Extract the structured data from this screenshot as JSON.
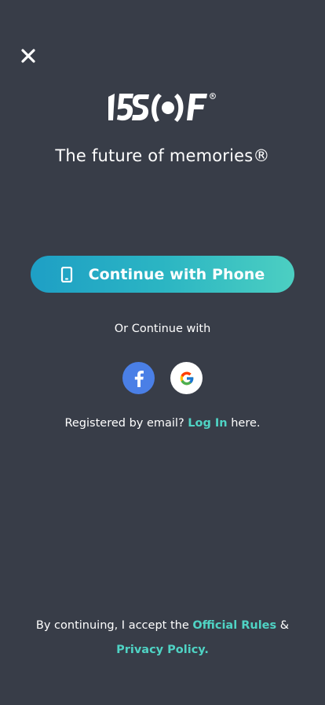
{
  "brand": {
    "logo_alt": "15SOF",
    "tagline": "The future of memories®",
    "accent_color": "#4fd3c4",
    "background_color": "#383d48"
  },
  "header": {
    "close_icon": "close-icon"
  },
  "auth": {
    "phone_button_label": "Continue with Phone",
    "phone_icon": "smartphone-icon",
    "or_continue_label": "Or Continue with",
    "social": [
      {
        "provider": "facebook",
        "icon": "facebook-icon",
        "color": "#4a7fe6"
      },
      {
        "provider": "google",
        "icon": "google-icon",
        "color": "#ffffff"
      }
    ],
    "registered_prefix": "Registered by email?",
    "login_link": "Log In",
    "registered_suffix": "here."
  },
  "footer": {
    "prefix": "By continuing, I accept the",
    "official_rules_link": "Official Rules",
    "ampersand": "&",
    "privacy_policy_link": "Privacy Policy."
  }
}
